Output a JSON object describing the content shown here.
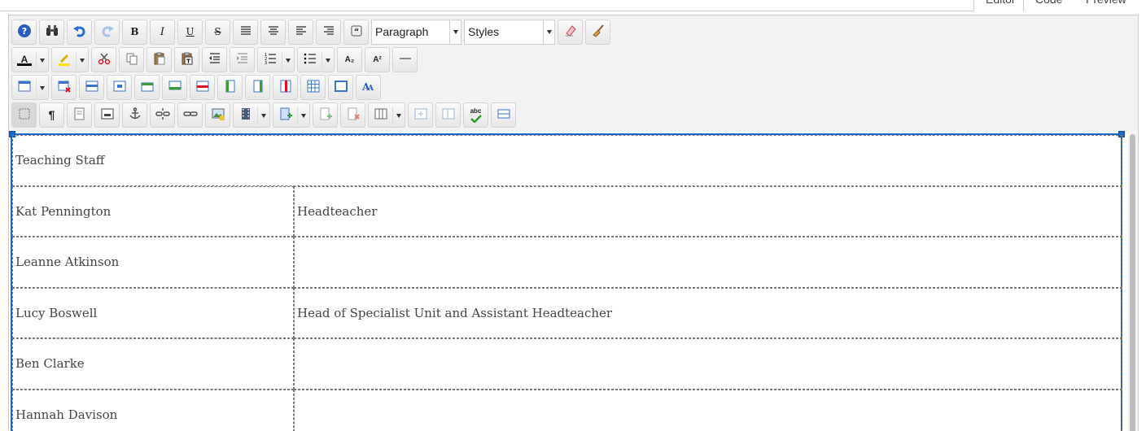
{
  "tabs": {
    "editor": "Editor",
    "code": "Code",
    "preview": "Preview"
  },
  "toolbar": {
    "format_select": "Paragraph",
    "styles_select": "Styles",
    "row1": [
      "help-icon",
      "find-icon",
      "undo-icon",
      "redo-icon",
      "bold-icon",
      "italic-icon",
      "underline-icon",
      "strikethrough-icon",
      "justify-icon",
      "align-center-icon",
      "align-left-icon",
      "align-right-icon",
      "blockquote-icon",
      "eraser-icon",
      "clean-broom-icon"
    ],
    "bold_label": "B",
    "italic_label": "I",
    "underline_label": "U",
    "strike_label": "S",
    "subscript_label": "A₂",
    "superscript_label": "A²",
    "font_color_label": "A",
    "spellcheck_label": "abc",
    "accent_color": "#1a67c9"
  },
  "table": {
    "header": "Teaching Staff",
    "rows": [
      {
        "name": "Kat Pennington",
        "role": "Headteacher"
      },
      {
        "name": "Leanne Atkinson",
        "role": ""
      },
      {
        "name": "Lucy Boswell",
        "role": "Head of Specialist Unit and Assistant Headteacher"
      },
      {
        "name": "Ben Clarke",
        "role": ""
      },
      {
        "name": "Hannah Davison",
        "role": ""
      }
    ]
  }
}
